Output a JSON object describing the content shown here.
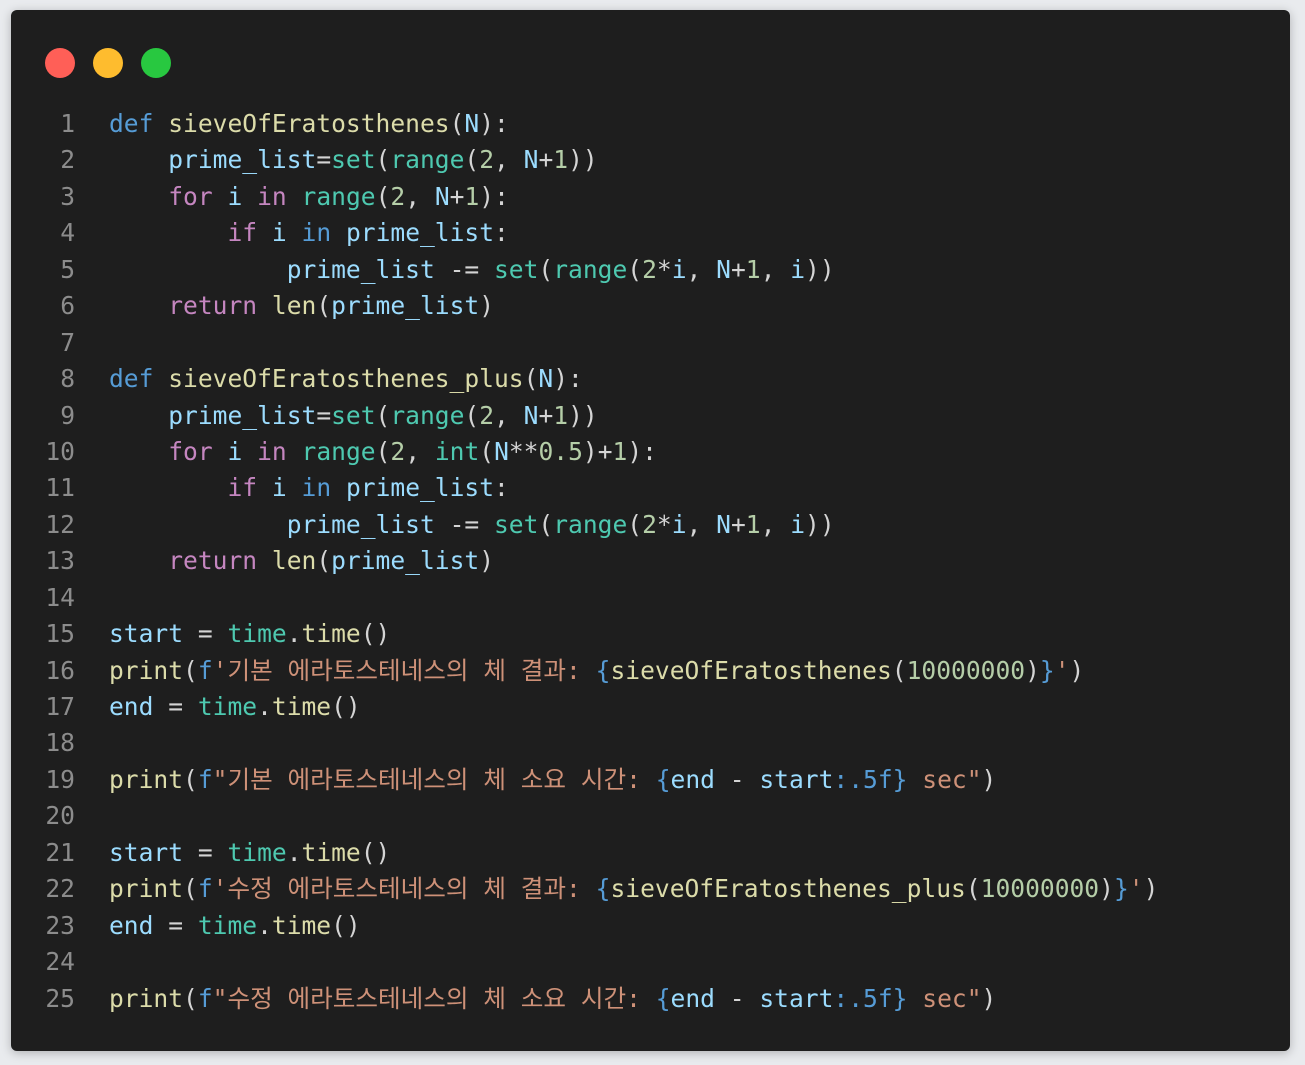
{
  "window": {
    "controls": [
      {
        "name": "close",
        "color": "#ff5f57"
      },
      {
        "name": "minimize",
        "color": "#febc2e"
      },
      {
        "name": "maximize",
        "color": "#28c840"
      }
    ]
  },
  "theme": {
    "background": "#1e1e1e",
    "line_number": "#8c8c8c",
    "default": "#d4d4d4",
    "keyword": "#569cd6",
    "control": "#c586c0",
    "function": "#dcdcaa",
    "builtin_type": "#4ec9b0",
    "variable": "#9cdcfe",
    "number": "#b5cea8",
    "string": "#ce9178"
  },
  "code": {
    "lines": [
      {
        "n": "1",
        "tokens": [
          [
            "keyword",
            "def"
          ],
          [
            "default",
            " "
          ],
          [
            "function",
            "sieveOfEratosthenes"
          ],
          [
            "default",
            "("
          ],
          [
            "variable",
            "N"
          ],
          [
            "default",
            "):"
          ]
        ]
      },
      {
        "n": "2",
        "tokens": [
          [
            "default",
            "    "
          ],
          [
            "variable",
            "prime_list"
          ],
          [
            "default",
            "="
          ],
          [
            "builtin_type",
            "set"
          ],
          [
            "default",
            "("
          ],
          [
            "builtin_type",
            "range"
          ],
          [
            "default",
            "("
          ],
          [
            "number",
            "2"
          ],
          [
            "default",
            ", "
          ],
          [
            "variable",
            "N"
          ],
          [
            "default",
            "+"
          ],
          [
            "number",
            "1"
          ],
          [
            "default",
            "))"
          ]
        ]
      },
      {
        "n": "3",
        "tokens": [
          [
            "default",
            "    "
          ],
          [
            "control",
            "for"
          ],
          [
            "default",
            " "
          ],
          [
            "variable",
            "i"
          ],
          [
            "default",
            " "
          ],
          [
            "control",
            "in"
          ],
          [
            "default",
            " "
          ],
          [
            "builtin_type",
            "range"
          ],
          [
            "default",
            "("
          ],
          [
            "number",
            "2"
          ],
          [
            "default",
            ", "
          ],
          [
            "variable",
            "N"
          ],
          [
            "default",
            "+"
          ],
          [
            "number",
            "1"
          ],
          [
            "default",
            "):"
          ]
        ]
      },
      {
        "n": "4",
        "tokens": [
          [
            "default",
            "        "
          ],
          [
            "control",
            "if"
          ],
          [
            "default",
            " "
          ],
          [
            "variable",
            "i"
          ],
          [
            "default",
            " "
          ],
          [
            "keyword",
            "in"
          ],
          [
            "default",
            " "
          ],
          [
            "variable",
            "prime_list"
          ],
          [
            "default",
            ":"
          ]
        ]
      },
      {
        "n": "5",
        "tokens": [
          [
            "default",
            "            "
          ],
          [
            "variable",
            "prime_list"
          ],
          [
            "default",
            " -= "
          ],
          [
            "builtin_type",
            "set"
          ],
          [
            "default",
            "("
          ],
          [
            "builtin_type",
            "range"
          ],
          [
            "default",
            "("
          ],
          [
            "number",
            "2"
          ],
          [
            "default",
            "*"
          ],
          [
            "variable",
            "i"
          ],
          [
            "default",
            ", "
          ],
          [
            "variable",
            "N"
          ],
          [
            "default",
            "+"
          ],
          [
            "number",
            "1"
          ],
          [
            "default",
            ", "
          ],
          [
            "variable",
            "i"
          ],
          [
            "default",
            "))"
          ]
        ]
      },
      {
        "n": "6",
        "tokens": [
          [
            "default",
            "    "
          ],
          [
            "control",
            "return"
          ],
          [
            "default",
            " "
          ],
          [
            "function",
            "len"
          ],
          [
            "default",
            "("
          ],
          [
            "variable",
            "prime_list"
          ],
          [
            "default",
            ")"
          ]
        ]
      },
      {
        "n": "7",
        "tokens": []
      },
      {
        "n": "8",
        "tokens": [
          [
            "keyword",
            "def"
          ],
          [
            "default",
            " "
          ],
          [
            "function",
            "sieveOfEratosthenes_plus"
          ],
          [
            "default",
            "("
          ],
          [
            "variable",
            "N"
          ],
          [
            "default",
            "):"
          ]
        ]
      },
      {
        "n": "9",
        "tokens": [
          [
            "default",
            "    "
          ],
          [
            "variable",
            "prime_list"
          ],
          [
            "default",
            "="
          ],
          [
            "builtin_type",
            "set"
          ],
          [
            "default",
            "("
          ],
          [
            "builtin_type",
            "range"
          ],
          [
            "default",
            "("
          ],
          [
            "number",
            "2"
          ],
          [
            "default",
            ", "
          ],
          [
            "variable",
            "N"
          ],
          [
            "default",
            "+"
          ],
          [
            "number",
            "1"
          ],
          [
            "default",
            "))"
          ]
        ]
      },
      {
        "n": "10",
        "tokens": [
          [
            "default",
            "    "
          ],
          [
            "control",
            "for"
          ],
          [
            "default",
            " "
          ],
          [
            "variable",
            "i"
          ],
          [
            "default",
            " "
          ],
          [
            "control",
            "in"
          ],
          [
            "default",
            " "
          ],
          [
            "builtin_type",
            "range"
          ],
          [
            "default",
            "("
          ],
          [
            "number",
            "2"
          ],
          [
            "default",
            ", "
          ],
          [
            "builtin_type",
            "int"
          ],
          [
            "default",
            "("
          ],
          [
            "variable",
            "N"
          ],
          [
            "default",
            "**"
          ],
          [
            "number",
            "0.5"
          ],
          [
            "default",
            ")+"
          ],
          [
            "number",
            "1"
          ],
          [
            "default",
            "):"
          ]
        ]
      },
      {
        "n": "11",
        "tokens": [
          [
            "default",
            "        "
          ],
          [
            "control",
            "if"
          ],
          [
            "default",
            " "
          ],
          [
            "variable",
            "i"
          ],
          [
            "default",
            " "
          ],
          [
            "keyword",
            "in"
          ],
          [
            "default",
            " "
          ],
          [
            "variable",
            "prime_list"
          ],
          [
            "default",
            ":"
          ]
        ]
      },
      {
        "n": "12",
        "tokens": [
          [
            "default",
            "            "
          ],
          [
            "variable",
            "prime_list"
          ],
          [
            "default",
            " -= "
          ],
          [
            "builtin_type",
            "set"
          ],
          [
            "default",
            "("
          ],
          [
            "builtin_type",
            "range"
          ],
          [
            "default",
            "("
          ],
          [
            "number",
            "2"
          ],
          [
            "default",
            "*"
          ],
          [
            "variable",
            "i"
          ],
          [
            "default",
            ", "
          ],
          [
            "variable",
            "N"
          ],
          [
            "default",
            "+"
          ],
          [
            "number",
            "1"
          ],
          [
            "default",
            ", "
          ],
          [
            "variable",
            "i"
          ],
          [
            "default",
            "))"
          ]
        ]
      },
      {
        "n": "13",
        "tokens": [
          [
            "default",
            "    "
          ],
          [
            "control",
            "return"
          ],
          [
            "default",
            " "
          ],
          [
            "function",
            "len"
          ],
          [
            "default",
            "("
          ],
          [
            "variable",
            "prime_list"
          ],
          [
            "default",
            ")"
          ]
        ]
      },
      {
        "n": "14",
        "tokens": []
      },
      {
        "n": "15",
        "tokens": [
          [
            "variable",
            "start"
          ],
          [
            "default",
            " = "
          ],
          [
            "builtin_type",
            "time"
          ],
          [
            "default",
            "."
          ],
          [
            "function",
            "time"
          ],
          [
            "default",
            "()"
          ]
        ]
      },
      {
        "n": "16",
        "tokens": [
          [
            "function",
            "print"
          ],
          [
            "default",
            "("
          ],
          [
            "keyword",
            "f"
          ],
          [
            "string",
            "'기본 에라토스테네스의 체 결과: "
          ],
          [
            "keyword",
            "{"
          ],
          [
            "function",
            "sieveOfEratosthenes"
          ],
          [
            "default",
            "("
          ],
          [
            "number",
            "10000000"
          ],
          [
            "default",
            ")"
          ],
          [
            "keyword",
            "}"
          ],
          [
            "string",
            "'"
          ],
          [
            "default",
            ")"
          ]
        ]
      },
      {
        "n": "17",
        "tokens": [
          [
            "variable",
            "end"
          ],
          [
            "default",
            " = "
          ],
          [
            "builtin_type",
            "time"
          ],
          [
            "default",
            "."
          ],
          [
            "function",
            "time"
          ],
          [
            "default",
            "()"
          ]
        ]
      },
      {
        "n": "18",
        "tokens": []
      },
      {
        "n": "19",
        "tokens": [
          [
            "function",
            "print"
          ],
          [
            "default",
            "("
          ],
          [
            "keyword",
            "f"
          ],
          [
            "string",
            "\"기본 에라토스테네스의 체 소요 시간: "
          ],
          [
            "keyword",
            "{"
          ],
          [
            "variable",
            "end"
          ],
          [
            "default",
            " - "
          ],
          [
            "variable",
            "start"
          ],
          [
            "keyword",
            ":.5f}"
          ],
          [
            "string",
            " sec\""
          ],
          [
            "default",
            ")"
          ]
        ]
      },
      {
        "n": "20",
        "tokens": []
      },
      {
        "n": "21",
        "tokens": [
          [
            "variable",
            "start"
          ],
          [
            "default",
            " = "
          ],
          [
            "builtin_type",
            "time"
          ],
          [
            "default",
            "."
          ],
          [
            "function",
            "time"
          ],
          [
            "default",
            "()"
          ]
        ]
      },
      {
        "n": "22",
        "tokens": [
          [
            "function",
            "print"
          ],
          [
            "default",
            "("
          ],
          [
            "keyword",
            "f"
          ],
          [
            "string",
            "'수정 에라토스테네스의 체 결과: "
          ],
          [
            "keyword",
            "{"
          ],
          [
            "function",
            "sieveOfEratosthenes_plus"
          ],
          [
            "default",
            "("
          ],
          [
            "number",
            "10000000"
          ],
          [
            "default",
            ")"
          ],
          [
            "keyword",
            "}"
          ],
          [
            "string",
            "'"
          ],
          [
            "default",
            ")"
          ]
        ]
      },
      {
        "n": "23",
        "tokens": [
          [
            "variable",
            "end"
          ],
          [
            "default",
            " = "
          ],
          [
            "builtin_type",
            "time"
          ],
          [
            "default",
            "."
          ],
          [
            "function",
            "time"
          ],
          [
            "default",
            "()"
          ]
        ]
      },
      {
        "n": "24",
        "tokens": []
      },
      {
        "n": "25",
        "tokens": [
          [
            "function",
            "print"
          ],
          [
            "default",
            "("
          ],
          [
            "keyword",
            "f"
          ],
          [
            "string",
            "\"수정 에라토스테네스의 체 소요 시간: "
          ],
          [
            "keyword",
            "{"
          ],
          [
            "variable",
            "end"
          ],
          [
            "default",
            " - "
          ],
          [
            "variable",
            "start"
          ],
          [
            "keyword",
            ":.5f}"
          ],
          [
            "string",
            " sec\""
          ],
          [
            "default",
            ")"
          ]
        ]
      }
    ]
  }
}
